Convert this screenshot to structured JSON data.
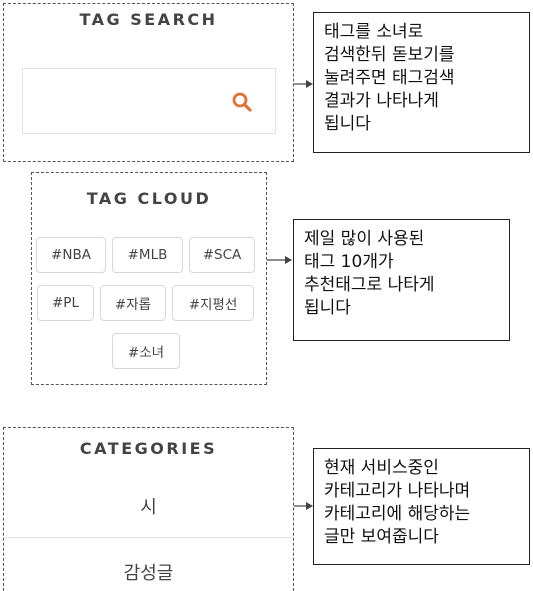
{
  "tag_search": {
    "title": "TAG SEARCH",
    "input_value": "",
    "search_icon": "search-icon",
    "note_lines": [
      "태그를 소녀로",
      "검색한뒤 돋보기를",
      "눌려주면 태그검색",
      "결과가 나타나게",
      "됩니다"
    ]
  },
  "tag_cloud": {
    "title": "TAG CLOUD",
    "tags": [
      "#NBA",
      "#MLB",
      "#SCA",
      "#PL",
      "#자롭",
      "#지평선",
      "#소녀"
    ],
    "note_lines": [
      "제일 많이 사용된",
      "태그 10개가",
      "추천태그로 나타게",
      "됩니다"
    ]
  },
  "categories": {
    "title": "CATEGORIES",
    "items": [
      "시",
      "감성글"
    ],
    "note_lines": [
      "현재 서비스중인",
      "카테고리가 나타나며",
      "카테고리에 해당하는",
      "글만 보여줍니다"
    ]
  },
  "colors": {
    "accent_orange": "#e0733a",
    "border_dashed": "#555555"
  }
}
